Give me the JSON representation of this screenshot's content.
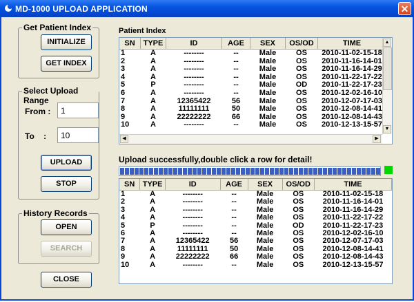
{
  "window": {
    "title": "MD-1000 UPLOAD APPLICATION",
    "close_glyph": "✕"
  },
  "get_patient_index": {
    "legend": "Get Patient Index",
    "initialize_label": "INITIALIZE",
    "get_index_label": "GET INDEX"
  },
  "upload_range": {
    "legend": "Select Upload Range",
    "from_label": "From :",
    "from_value": "1",
    "to_label": "To    :",
    "to_value": "10",
    "upload_label": "UPLOAD",
    "stop_label": "STOP"
  },
  "history": {
    "legend": "History Records",
    "open_label": "OPEN",
    "search_label": "SEARCH"
  },
  "close_label": "CLOSE",
  "patient_index": {
    "title": "Patient Index",
    "columns": [
      "SN",
      "TYPE",
      "ID",
      "AGE",
      "SEX",
      "OS/OD",
      "TIME"
    ]
  },
  "status_text": "Upload successfully,double click a row for detail!",
  "progress_percent": 100,
  "rows": [
    [
      "1",
      "A",
      "--------",
      "--",
      "Male",
      "OS",
      "2010-11-02-15-18"
    ],
    [
      "2",
      "A",
      "--------",
      "--",
      "Male",
      "OS",
      "2010-11-16-14-01"
    ],
    [
      "3",
      "A",
      "--------",
      "--",
      "Male",
      "OS",
      "2010-11-16-14-29"
    ],
    [
      "4",
      "A",
      "--------",
      "--",
      "Male",
      "OS",
      "2010-11-22-17-22"
    ],
    [
      "5",
      "P",
      "--------",
      "--",
      "Male",
      "OD",
      "2010-11-22-17-23"
    ],
    [
      "6",
      "A",
      "--------",
      "--",
      "Male",
      "OS",
      "2010-12-02-16-10"
    ],
    [
      "7",
      "A",
      "12365422",
      "56",
      "Male",
      "OS",
      "2010-12-07-17-03"
    ],
    [
      "8",
      "A",
      "11111111",
      "50",
      "Male",
      "OS",
      "2010-12-08-14-41"
    ],
    [
      "9",
      "A",
      "22222222",
      "66",
      "Male",
      "OS",
      "2010-12-08-14-43"
    ],
    [
      "10",
      "A",
      "--------",
      "--",
      "Male",
      "OS",
      "2010-12-13-15-57"
    ]
  ],
  "colors": {
    "titlebar": "#0654e0",
    "led": "#00d800",
    "progress": "#3a5fc0"
  }
}
